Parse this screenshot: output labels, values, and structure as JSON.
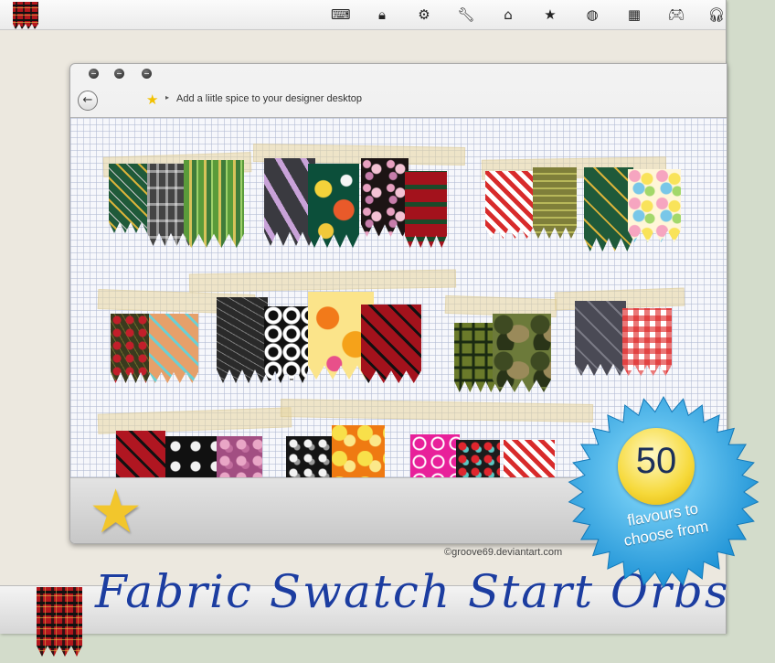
{
  "top_bar": {
    "orb_icon": "fabric-swatch-orb-icon",
    "tray_icons": [
      {
        "name": "keyboard-icon",
        "glyph": "⌨"
      },
      {
        "name": "lock-icon",
        "glyph": "🔒︎"
      },
      {
        "name": "gear-icon",
        "glyph": "⚙"
      },
      {
        "name": "wrench-icon",
        "glyph": "🔧︎"
      },
      {
        "name": "home-icon",
        "glyph": "⌂"
      },
      {
        "name": "star-icon",
        "glyph": "★"
      },
      {
        "name": "globe-icon",
        "glyph": "◍"
      },
      {
        "name": "calculator-icon",
        "glyph": "▦"
      },
      {
        "name": "gamepad-icon",
        "glyph": "🎮︎"
      },
      {
        "name": "headphones-icon",
        "glyph": "🎧︎"
      }
    ]
  },
  "window": {
    "address_text": "Add a liitle spice to your designer desktop",
    "back_icon": "back-arrow-icon",
    "favorite_icon": "star-icon"
  },
  "credit": "©groove69.deviantart.com",
  "title": "Fabric Swatch Start Orbs",
  "badge": {
    "number": "50",
    "text_line1": "flavours to",
    "text_line2": "choose from",
    "colors": {
      "burst": "#3bb3e8",
      "circle": "#f6d93a"
    }
  },
  "colors": {
    "accent_blue": "#1c3da0",
    "panel_bg": "#ece8df",
    "desktop_bg": "#d3dccb"
  },
  "swatches": [
    "green-gold-stripe",
    "grey-plaid",
    "green-gold-stripe-light",
    "lilac-stripe",
    "japanese-floral",
    "pink-floral-black",
    "red-green-tartan",
    "red-white-plaid",
    "olive-check",
    "green-gold-stripe",
    "pastel-floral",
    "black-red-hexagon",
    "peach-teal-plaid",
    "black-geometric",
    "black-white-circles",
    "orange-floral",
    "red-black-tartan",
    "green-squares",
    "camo",
    "grey-plaid-pink",
    "red-gingham",
    "red-black-tartan",
    "skulls",
    "pink-damask",
    "black-polka-dot",
    "orange-flowers",
    "pink-hearts",
    "red-teal-dots",
    "red-white-plaid"
  ]
}
